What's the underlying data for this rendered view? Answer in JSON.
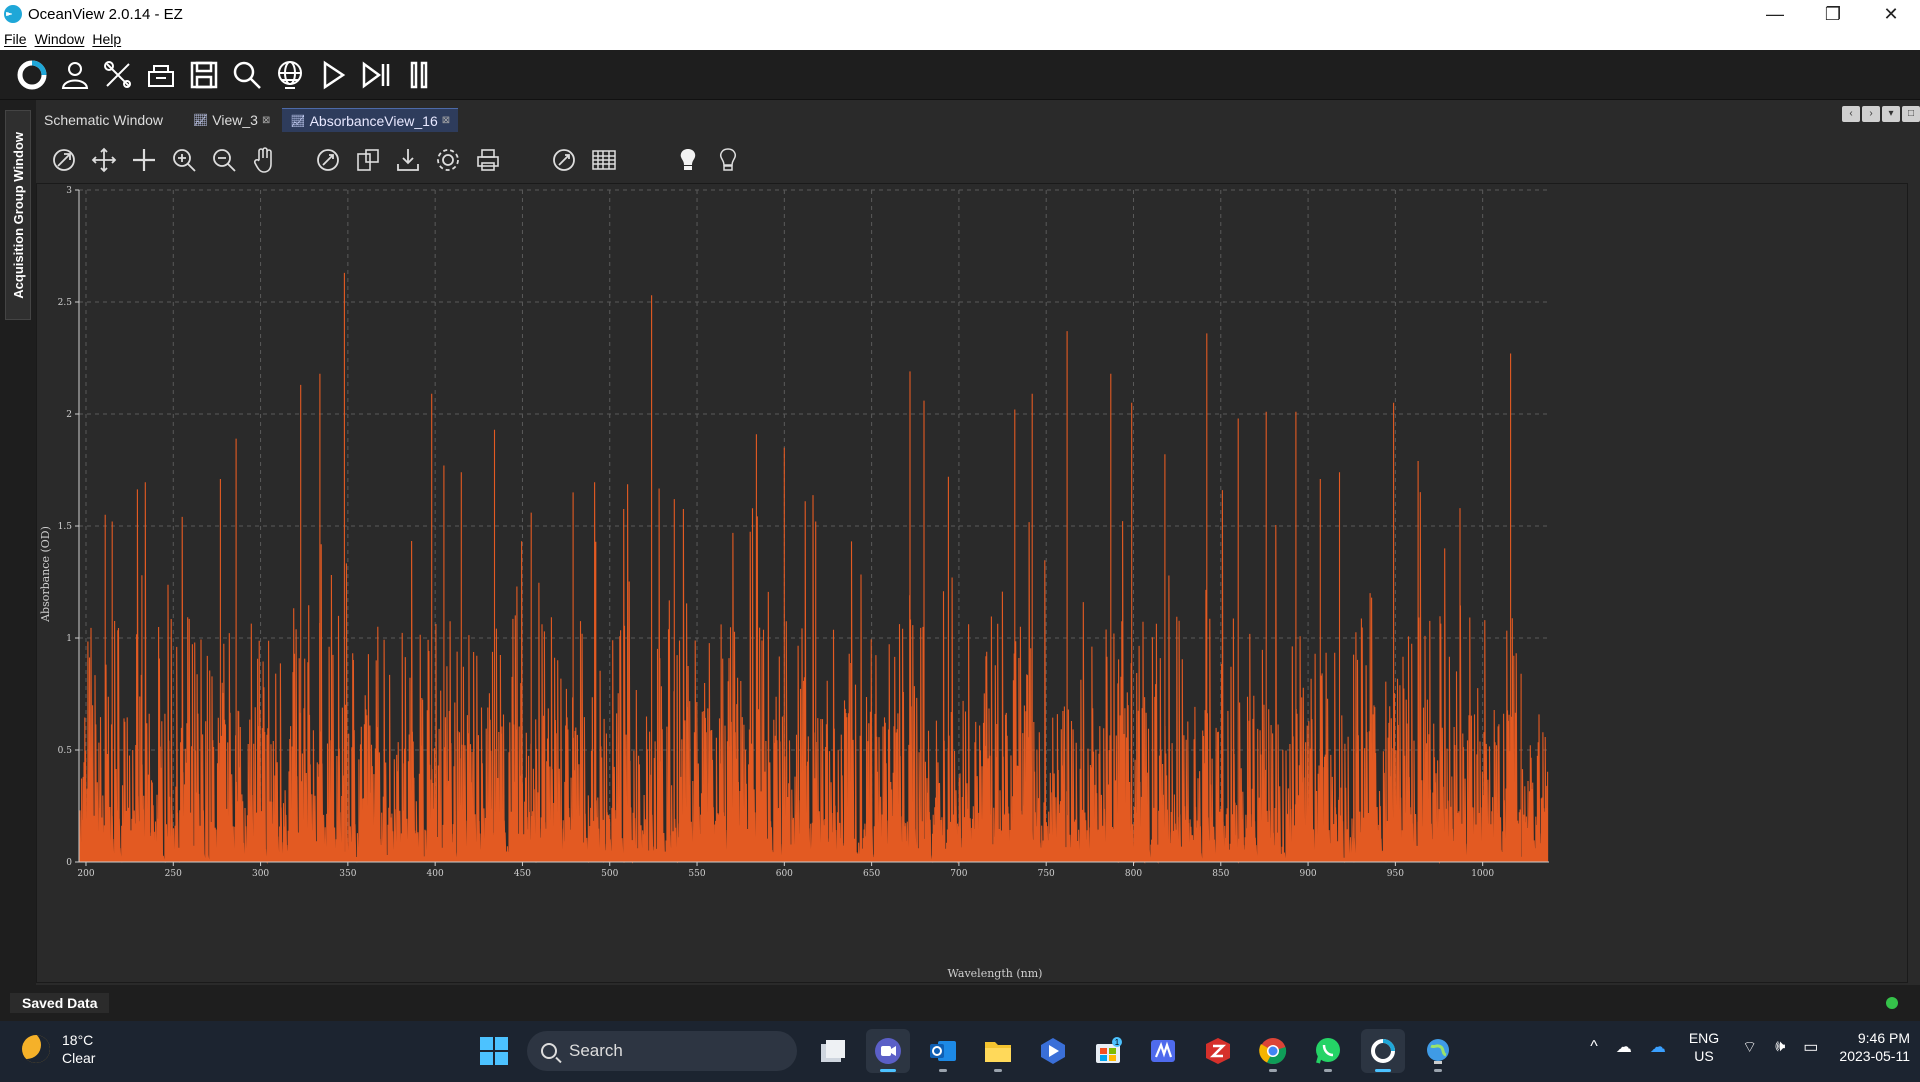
{
  "window": {
    "title": "OceanView 2.0.14  - EZ",
    "minimize": "—",
    "restore": "❐",
    "close": "✕"
  },
  "menu": [
    "File",
    "Window",
    "Help"
  ],
  "main_toolbar": {
    "icons": [
      "oceanview-logo-icon",
      "user-icon",
      "tools-icon",
      "device-icon",
      "save-icon",
      "search-icon",
      "globe-icon",
      "play-icon",
      "step-icon",
      "pause-icon"
    ]
  },
  "left_panel": {
    "label": "Acquisition Group Window"
  },
  "tabs": [
    {
      "label": "Schematic Window",
      "active": false,
      "chart_icon": false,
      "closable": false
    },
    {
      "label": "View_3",
      "active": false,
      "chart_icon": true,
      "closable": true
    },
    {
      "label": "AbsorbanceView_16",
      "active": true,
      "chart_icon": true,
      "closable": true
    }
  ],
  "graph_toolbar": {
    "icons": [
      "autoscale-icon",
      "pan-icon",
      "move-icon",
      "zoom-in-icon",
      "zoom-out-icon",
      "hand-icon",
      "reset-icon",
      "copy-icon",
      "export-icon",
      "settings-icon",
      "print-icon",
      "overlay-icon",
      "table-icon",
      "light-on-icon",
      "light-off-icon"
    ]
  },
  "chart_data": {
    "type": "line",
    "xlabel": "Wavelength (nm)",
    "ylabel": "Absorbance (OD)",
    "xlim": [
      196,
      1038
    ],
    "ylim": [
      0,
      3.0
    ],
    "xticks": [
      200,
      250,
      300,
      350,
      400,
      450,
      500,
      550,
      600,
      650,
      700,
      750,
      800,
      850,
      900,
      950,
      1000
    ],
    "yticks": [
      0,
      0.5,
      1,
      1.5,
      2,
      2.5,
      3
    ],
    "ytick_labels": [
      "0",
      "0.5",
      "1",
      "1.5",
      "2",
      "2.5",
      "3"
    ],
    "grid": true,
    "series_color": "#e35a22",
    "background": "#2a2a2a",
    "noise_range": [
      0,
      1.7
    ],
    "peaks": [
      {
        "x": 211,
        "y": 1.55
      },
      {
        "x": 215,
        "y": 1.52
      },
      {
        "x": 232,
        "y": 1.28
      },
      {
        "x": 277,
        "y": 1.71
      },
      {
        "x": 286,
        "y": 1.89
      },
      {
        "x": 323,
        "y": 2.13
      },
      {
        "x": 334,
        "y": 2.18
      },
      {
        "x": 348,
        "y": 2.63
      },
      {
        "x": 398,
        "y": 2.09
      },
      {
        "x": 405,
        "y": 1.77
      },
      {
        "x": 415,
        "y": 1.74
      },
      {
        "x": 434,
        "y": 1.93
      },
      {
        "x": 455,
        "y": 1.56
      },
      {
        "x": 479,
        "y": 1.65
      },
      {
        "x": 492,
        "y": 1.43
      },
      {
        "x": 524,
        "y": 2.53
      },
      {
        "x": 537,
        "y": 1.62
      },
      {
        "x": 584,
        "y": 1.91
      },
      {
        "x": 600,
        "y": 1.85
      },
      {
        "x": 618,
        "y": 1.52
      },
      {
        "x": 672,
        "y": 2.19
      },
      {
        "x": 680,
        "y": 2.06
      },
      {
        "x": 694,
        "y": 1.72
      },
      {
        "x": 732,
        "y": 2.02
      },
      {
        "x": 742,
        "y": 2.09
      },
      {
        "x": 762,
        "y": 2.37
      },
      {
        "x": 787,
        "y": 2.18
      },
      {
        "x": 799,
        "y": 2.05
      },
      {
        "x": 818,
        "y": 1.82
      },
      {
        "x": 842,
        "y": 2.36
      },
      {
        "x": 860,
        "y": 1.98
      },
      {
        "x": 876,
        "y": 2.01
      },
      {
        "x": 893,
        "y": 2.01
      },
      {
        "x": 907,
        "y": 1.71
      },
      {
        "x": 918,
        "y": 1.74
      },
      {
        "x": 949,
        "y": 2.05
      },
      {
        "x": 963,
        "y": 1.79
      },
      {
        "x": 987,
        "y": 1.58
      },
      {
        "x": 1016,
        "y": 2.27
      },
      {
        "x": 1022,
        "y": 0.84
      }
    ]
  },
  "status": {
    "saved_label": "Saved Data",
    "indicator_color": "#35c24a"
  },
  "taskbar": {
    "weather_temp": "18°C",
    "weather_desc": "Clear",
    "search_label": "Search",
    "apps": [
      "windows-start-icon",
      "search",
      "file-explorer-small-icon",
      "teams-icon",
      "outlook-icon",
      "folder-icon",
      "visual-icon",
      "store-icon",
      "ms-app-icon",
      "red-app-icon",
      "chrome-icon",
      "whatsapp-icon",
      "oceanview-taskbar-icon",
      "web-icon"
    ],
    "store_badge": "1",
    "lang_top": "ENG",
    "lang_bottom": "US",
    "time": "9:46 PM",
    "date": "2023-05-11"
  }
}
